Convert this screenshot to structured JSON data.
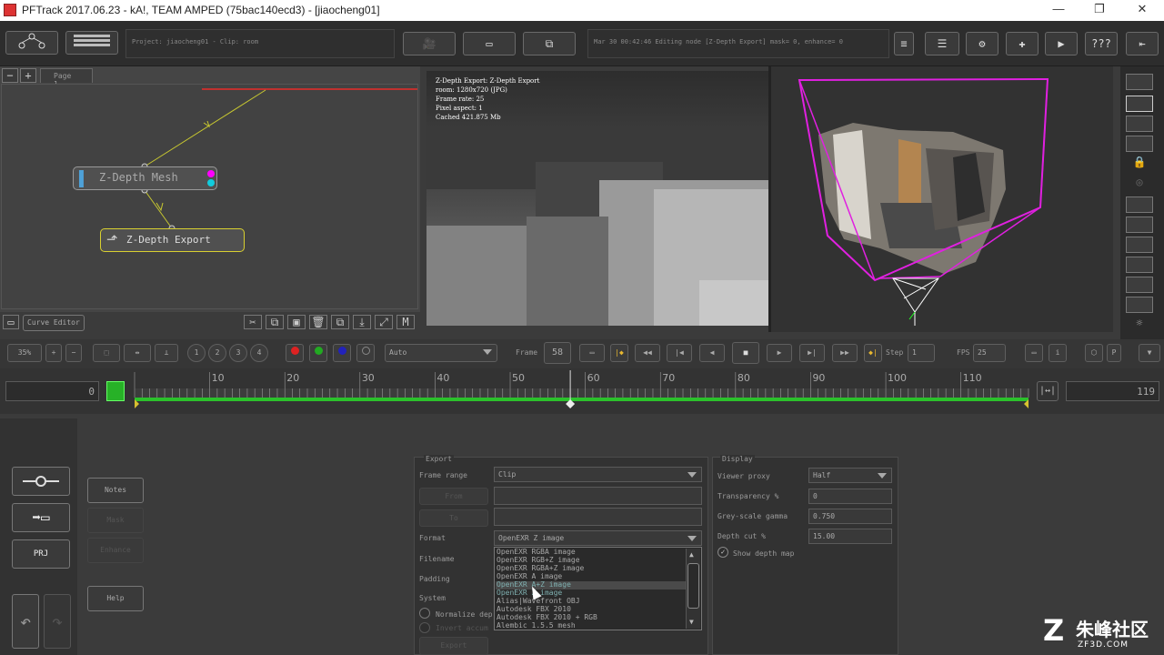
{
  "window": {
    "title": "PFTrack 2017.06.23 - kA!, TEAM AMPED (75bac140ecd3) - [jiaocheng01]"
  },
  "toolbar": {
    "project_info": "Project: jiaocheng01 - Clip: room",
    "status": "Mar 30 00:42:46 Editing node [Z-Depth Export] mask= 0, enhance= 0",
    "help_label": "???"
  },
  "nodes": {
    "page_tab": "Page 1",
    "mesh_label": "Z-Depth Mesh",
    "export_label": "Z-Depth Export",
    "curve_editor": "Curve Editor"
  },
  "viewer": {
    "info": [
      "Z-Depth Export: Z-Depth Export",
      "room: 1280x720 (JPG)",
      "Frame rate: 25",
      "Pixel aspect: 1",
      "Cached 421.875 Mb"
    ]
  },
  "transport": {
    "zoom": "35%",
    "pages": [
      "1",
      "2",
      "3",
      "4"
    ],
    "auto": "Auto",
    "frame_label": "Frame",
    "frame_value": "58",
    "step_label": "Step",
    "step_value": "1",
    "fps_label": "FPS",
    "fps_value": "25"
  },
  "timeline": {
    "start": "0",
    "end": "119",
    "ticks": [
      "10",
      "20",
      "30",
      "40",
      "50",
      "60",
      "70",
      "80",
      "90",
      "100",
      "110"
    ],
    "current_frame": 58
  },
  "left_buttons": {
    "notes": "Notes",
    "mask": "Mask",
    "enhance": "Enhance",
    "help": "Help",
    "prj": "PRJ"
  },
  "export": {
    "title": "Export",
    "frame_range_label": "Frame range",
    "frame_range_value": "Clip",
    "from_label": "From",
    "to_label": "To",
    "format_label": "Format",
    "format_value": "OpenEXR Z image",
    "filename_label": "Filename",
    "padding_label": "Padding",
    "system_label": "System",
    "normalize_label": "Normalize dep",
    "invert_label": "Invert accum",
    "export_button": "Export",
    "options": [
      "OpenEXR RGBA image",
      "OpenEXR RGB+Z image",
      "OpenEXR RGBA+Z image",
      "OpenEXR A image",
      "OpenEXR A+Z image",
      "OpenEXR Z image",
      "Alias|Wavefront OBJ",
      "Autodesk FBX 2010",
      "Autodesk FBX 2010 + RGB",
      "Alembic 1.5.5 mesh"
    ],
    "highlighted_index": 4
  },
  "display": {
    "title": "Display",
    "viewer_proxy_label": "Viewer proxy",
    "viewer_proxy_value": "Half",
    "transparency_label": "Transparency %",
    "transparency_value": "0",
    "gamma_label": "Grey-scale gamma",
    "gamma_value": "0.750",
    "depth_cut_label": "Depth cut %",
    "depth_cut_value": "15.00",
    "show_depth_label": "Show depth map"
  },
  "watermark": {
    "logo": "朱峰社区",
    "url": "ZF3D.COM"
  }
}
